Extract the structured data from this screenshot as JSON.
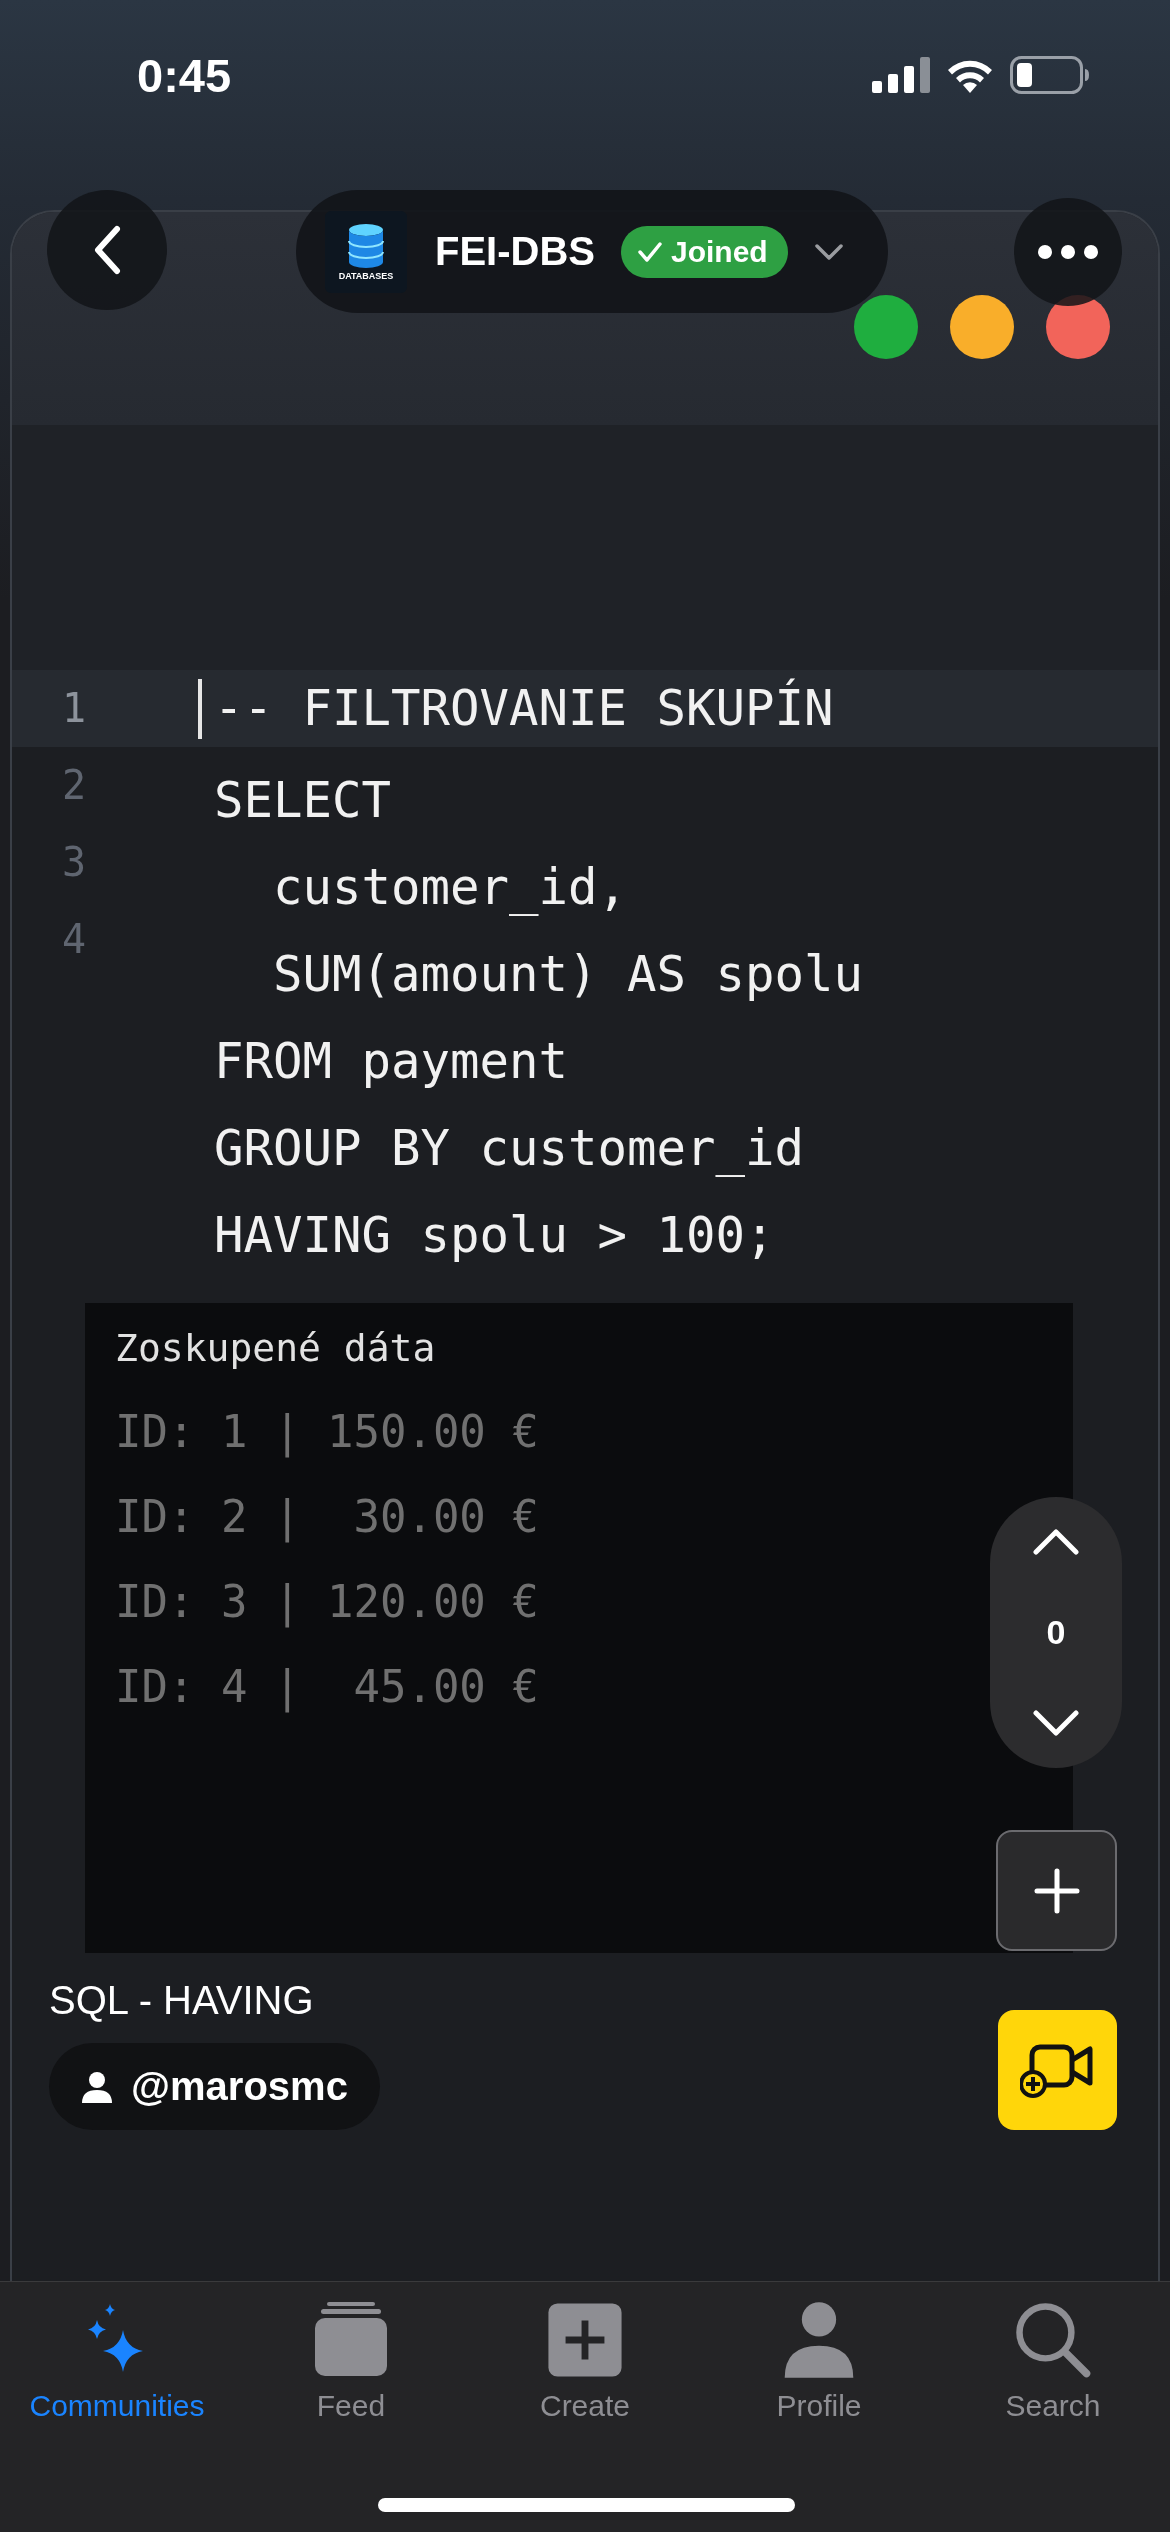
{
  "status_bar": {
    "time": "0:45"
  },
  "community": {
    "logo_caption": "DATABASES",
    "name": "FEI-DBS",
    "joined_label": "Joined"
  },
  "editor": {
    "window_dots": [
      {
        "color": "#1fae3f"
      },
      {
        "color": "#f9ae2a"
      },
      {
        "color": "#f2645a"
      }
    ],
    "line_numbers": [
      "1",
      "2",
      "3",
      "4"
    ],
    "code_lines": [
      {
        "text": "-- FILTROVANIE SKUPÍN",
        "current": true
      },
      {
        "text": "SELECT",
        "current": false
      },
      {
        "text": "  customer_id,",
        "current": false
      },
      {
        "text": "  SUM(amount) AS spolu",
        "current": false
      },
      {
        "text": "FROM payment",
        "current": false
      },
      {
        "text": "GROUP BY customer_id",
        "current": false
      },
      {
        "text": "HAVING spolu > 100;",
        "current": false
      }
    ],
    "output": {
      "title": "Zoskupené dáta",
      "rows": [
        "ID: 1 | 150.00 €",
        "ID: 2 |  30.00 €",
        "ID: 3 | 120.00 €",
        "ID: 4 |  45.00 €"
      ]
    }
  },
  "scroll_control": {
    "count": "0"
  },
  "video": {
    "title": "SQL - HAVING",
    "author": "@marosmc"
  },
  "tabs": [
    {
      "label": "Communities",
      "selected": true
    },
    {
      "label": "Feed",
      "selected": false
    },
    {
      "label": "Create",
      "selected": false
    },
    {
      "label": "Profile",
      "selected": false
    },
    {
      "label": "Search",
      "selected": false
    }
  ]
}
